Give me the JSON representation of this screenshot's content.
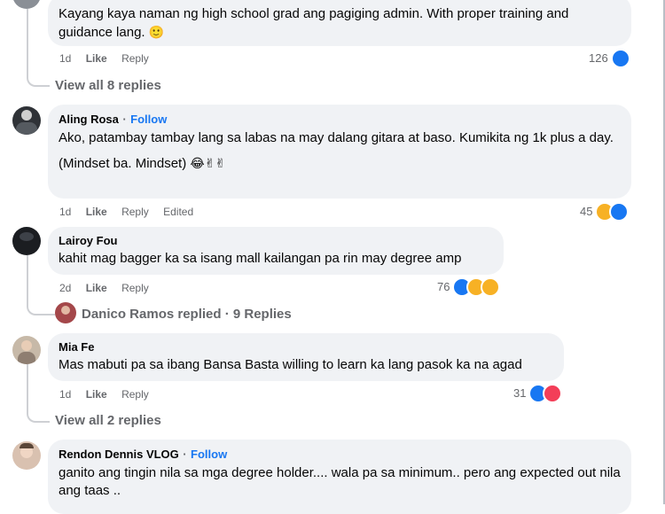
{
  "comments": [
    {
      "text": "Kayang kaya naman ng high school grad ang pagiging admin. With proper training and guidance lang.",
      "emoji": "🙂",
      "time": "1d",
      "like": "Like",
      "reply": "Reply",
      "count": "126",
      "view_replies": "View all 8 replies"
    },
    {
      "name": "Aling Rosa",
      "follow": "Follow",
      "dot": "·",
      "text": "Ako, patambay tambay lang sa labas na may dalang gitara at baso. Kumikita ng 1k plus a day.",
      "text2": "(Mindset ba. Mindset)",
      "emoji2": "😂✌✌",
      "time": "1d",
      "like": "Like",
      "reply": "Reply",
      "edited": "Edited",
      "count": "45"
    },
    {
      "name": "Lairoy Fou",
      "text": "kahit mag bagger ka sa isang mall kailangan pa rin may degree amp",
      "time": "2d",
      "like": "Like",
      "reply": "Reply",
      "count": "76",
      "replied": "Danico Ramos replied · 9 Replies"
    },
    {
      "name": "Mia Fe",
      "text": "Mas mabuti pa sa ibang Bansa Basta willing to learn ka lang pasok ka na agad",
      "time": "1d",
      "like": "Like",
      "reply": "Reply",
      "count": "31",
      "view_replies": "View all 2 replies"
    },
    {
      "name": "Rendon Dennis VLOG",
      "follow": "Follow",
      "dot": "·",
      "text": "ganito ang tingin nila sa mga degree holder.... wala pa sa minimum.. pero ang expected out nila ang taas .."
    }
  ],
  "colors": {
    "like": "#1877f2",
    "link": "#1877f2",
    "bubble": "#f0f2f5",
    "muted": "#65676b"
  }
}
